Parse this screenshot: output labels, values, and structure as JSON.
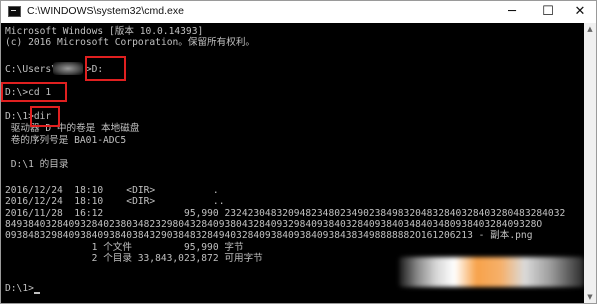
{
  "window": {
    "title": "C:\\WINDOWS\\system32\\cmd.exe",
    "controls": {
      "minimize": "─",
      "maximize": "☐",
      "close": "✕"
    }
  },
  "console": {
    "line_1": "Microsoft Windows [版本 10.0.14393]",
    "line_2": "(c) 2016 Microsoft Corporation。保留所有权利。",
    "line_3": "C:\\Users\\     >D:",
    "line_4": "D:\\>cd 1",
    "line_5": "D:\\1>dir",
    "line_6": " 驱动器 D 中的卷是 本地磁盘",
    "line_7": " 卷的序列号是 BA01-ADC5",
    "line_8": " D:\\1 的目录",
    "line_9": "2016/12/24  18:10    <DIR>          .",
    "line_10": "2016/12/24  18:10    <DIR>          ..",
    "line_11": "2016/11/28  16:12              95,990 23242304832094823480234902384983204832840328403280483284032",
    "line_12": "84938403284093284023803482329804328409380432840932984093840328409384034840348093840328409328O",
    "line_13": "09384832984093840938403843290384832849403284093840938409384383498888882O161206213 - 副本.png",
    "line_14": "               1 个文件         95,990 字节",
    "line_15": "               2 个目录 33,843,023,872 可用字节",
    "line_16": "D:\\1>"
  },
  "colors": {
    "console_bg": "#000000",
    "console_text": "#c0c0c0",
    "highlight": "#e02020",
    "titlebar_bg": "#ffffff"
  },
  "icons": {
    "app": "cmd-icon"
  }
}
